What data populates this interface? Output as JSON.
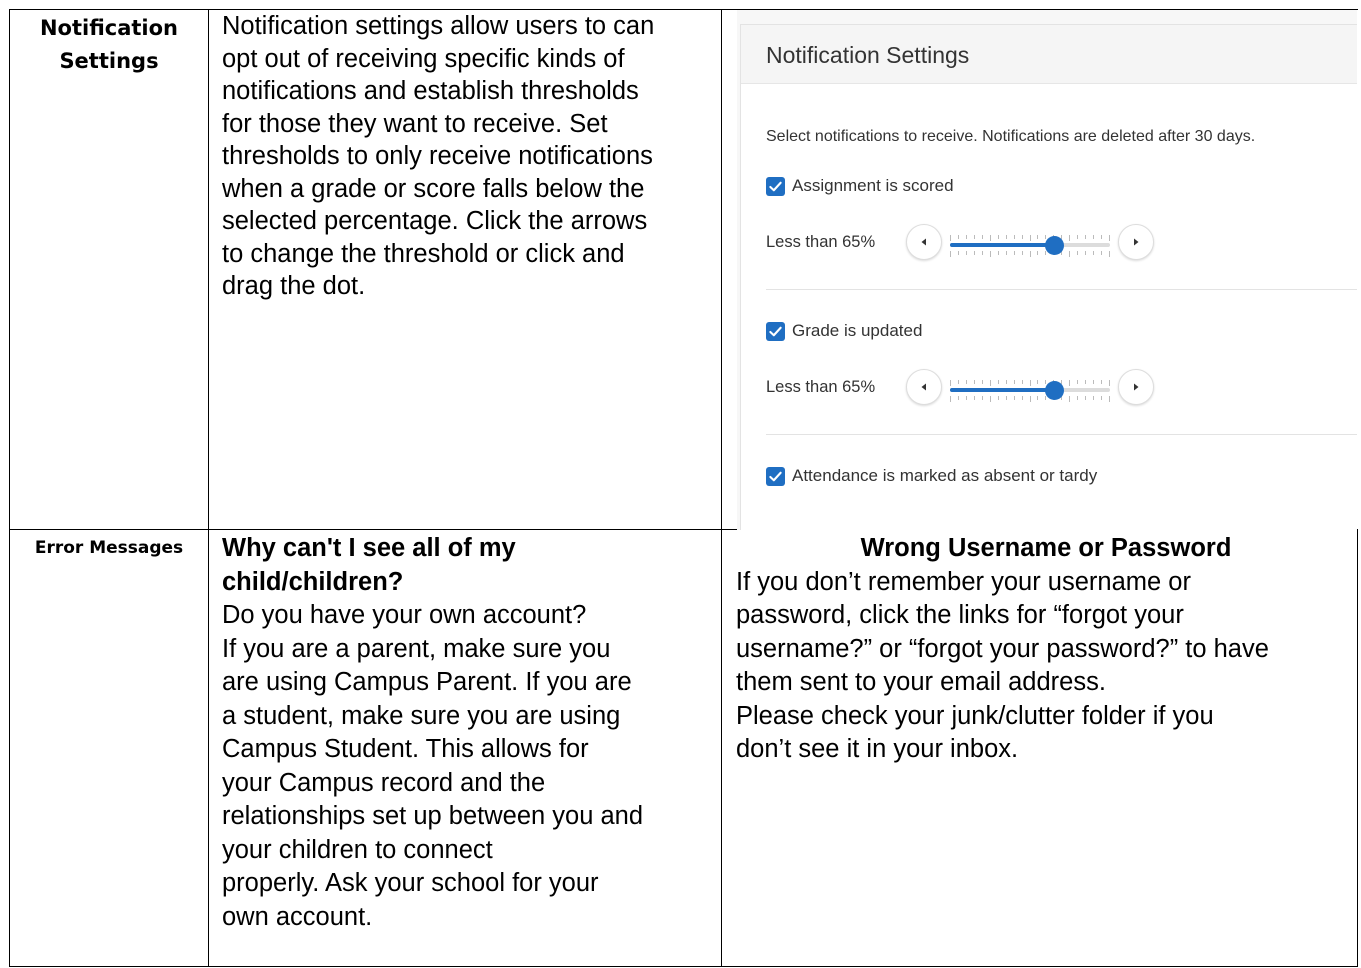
{
  "row1": {
    "heading": "Notification Settings",
    "description": [
      "Notification settings allow users to can",
      "opt out of receiving specific kinds of",
      "notifications and establish thresholds",
      "for those they want to receive. Set",
      "thresholds to only receive notifications",
      "when a grade or score falls below the",
      "selected percentage. Click the arrows",
      "to change the threshold or click and",
      "drag the dot."
    ],
    "screenshot": {
      "title": "Notification Settings",
      "intro": "Select notifications to receive. Notifications are deleted after 30 days.",
      "items": [
        {
          "label": "Assignment is scored",
          "checked": true,
          "threshold_label": "Less than 65%",
          "threshold_value": 0.65
        },
        {
          "label": "Grade is updated",
          "checked": true,
          "threshold_label": "Less than 65%",
          "threshold_value": 0.65
        },
        {
          "label": "Attendance is marked as absent or tardy",
          "checked": true
        }
      ],
      "icons": {
        "checkbox": "checkmark-icon",
        "decrease": "arrow-left-icon",
        "increase": "arrow-right-icon"
      },
      "accent_color": "#1f6ec2"
    }
  },
  "row2": {
    "heading": "Error Messages",
    "faq": {
      "question_lines": [
        "Why can't I see all of my",
        "child/children?"
      ],
      "lines": [
        "Do you have your own account?",
        "If you are a parent, make sure you",
        "are using Campus Parent. If you are",
        "a student, make sure you are using",
        "Campus Student. This allows for",
        "your Campus record and the",
        "relationships set up between you and",
        "your children to connect",
        "properly. Ask your school for your",
        "own account."
      ]
    },
    "wrong": {
      "title": "Wrong Username or Password",
      "lines": [
        "If you don’t remember your username or",
        "password, click the links for “forgot your",
        "username?” or “forgot your password?” to have",
        "them sent to your email address.",
        "Please check your junk/clutter folder if you",
        "don’t see it in your inbox."
      ]
    }
  }
}
